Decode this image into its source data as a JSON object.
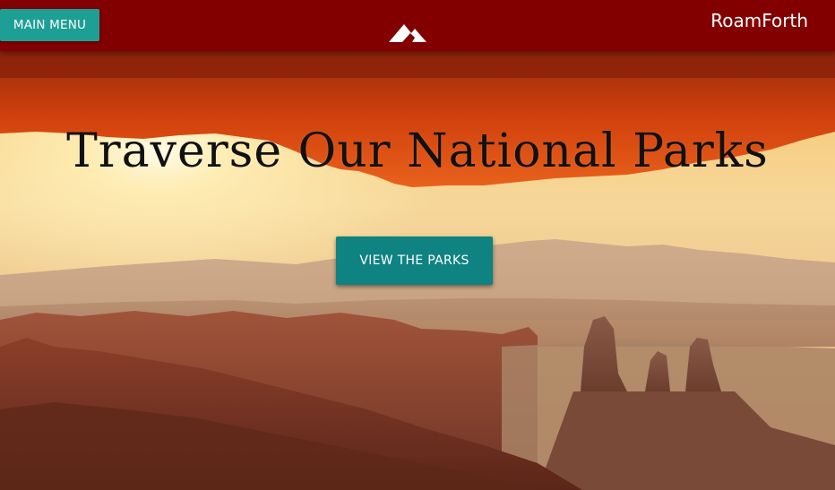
{
  "header": {
    "menu_label": "MAIN MENU",
    "logo_icon": "mountain-logo-icon",
    "brand": "RoamForth"
  },
  "hero": {
    "headline": "Traverse Our National Parks",
    "cta_label": "VIEW THE PARKS",
    "background": "canyon sunrise arch photo"
  },
  "colors": {
    "header_bg": "#820000",
    "menu_button_bg": "#1e9f95",
    "cta_bg": "#0f8282",
    "text_light": "#ffffff",
    "headline_text": "#111111"
  }
}
